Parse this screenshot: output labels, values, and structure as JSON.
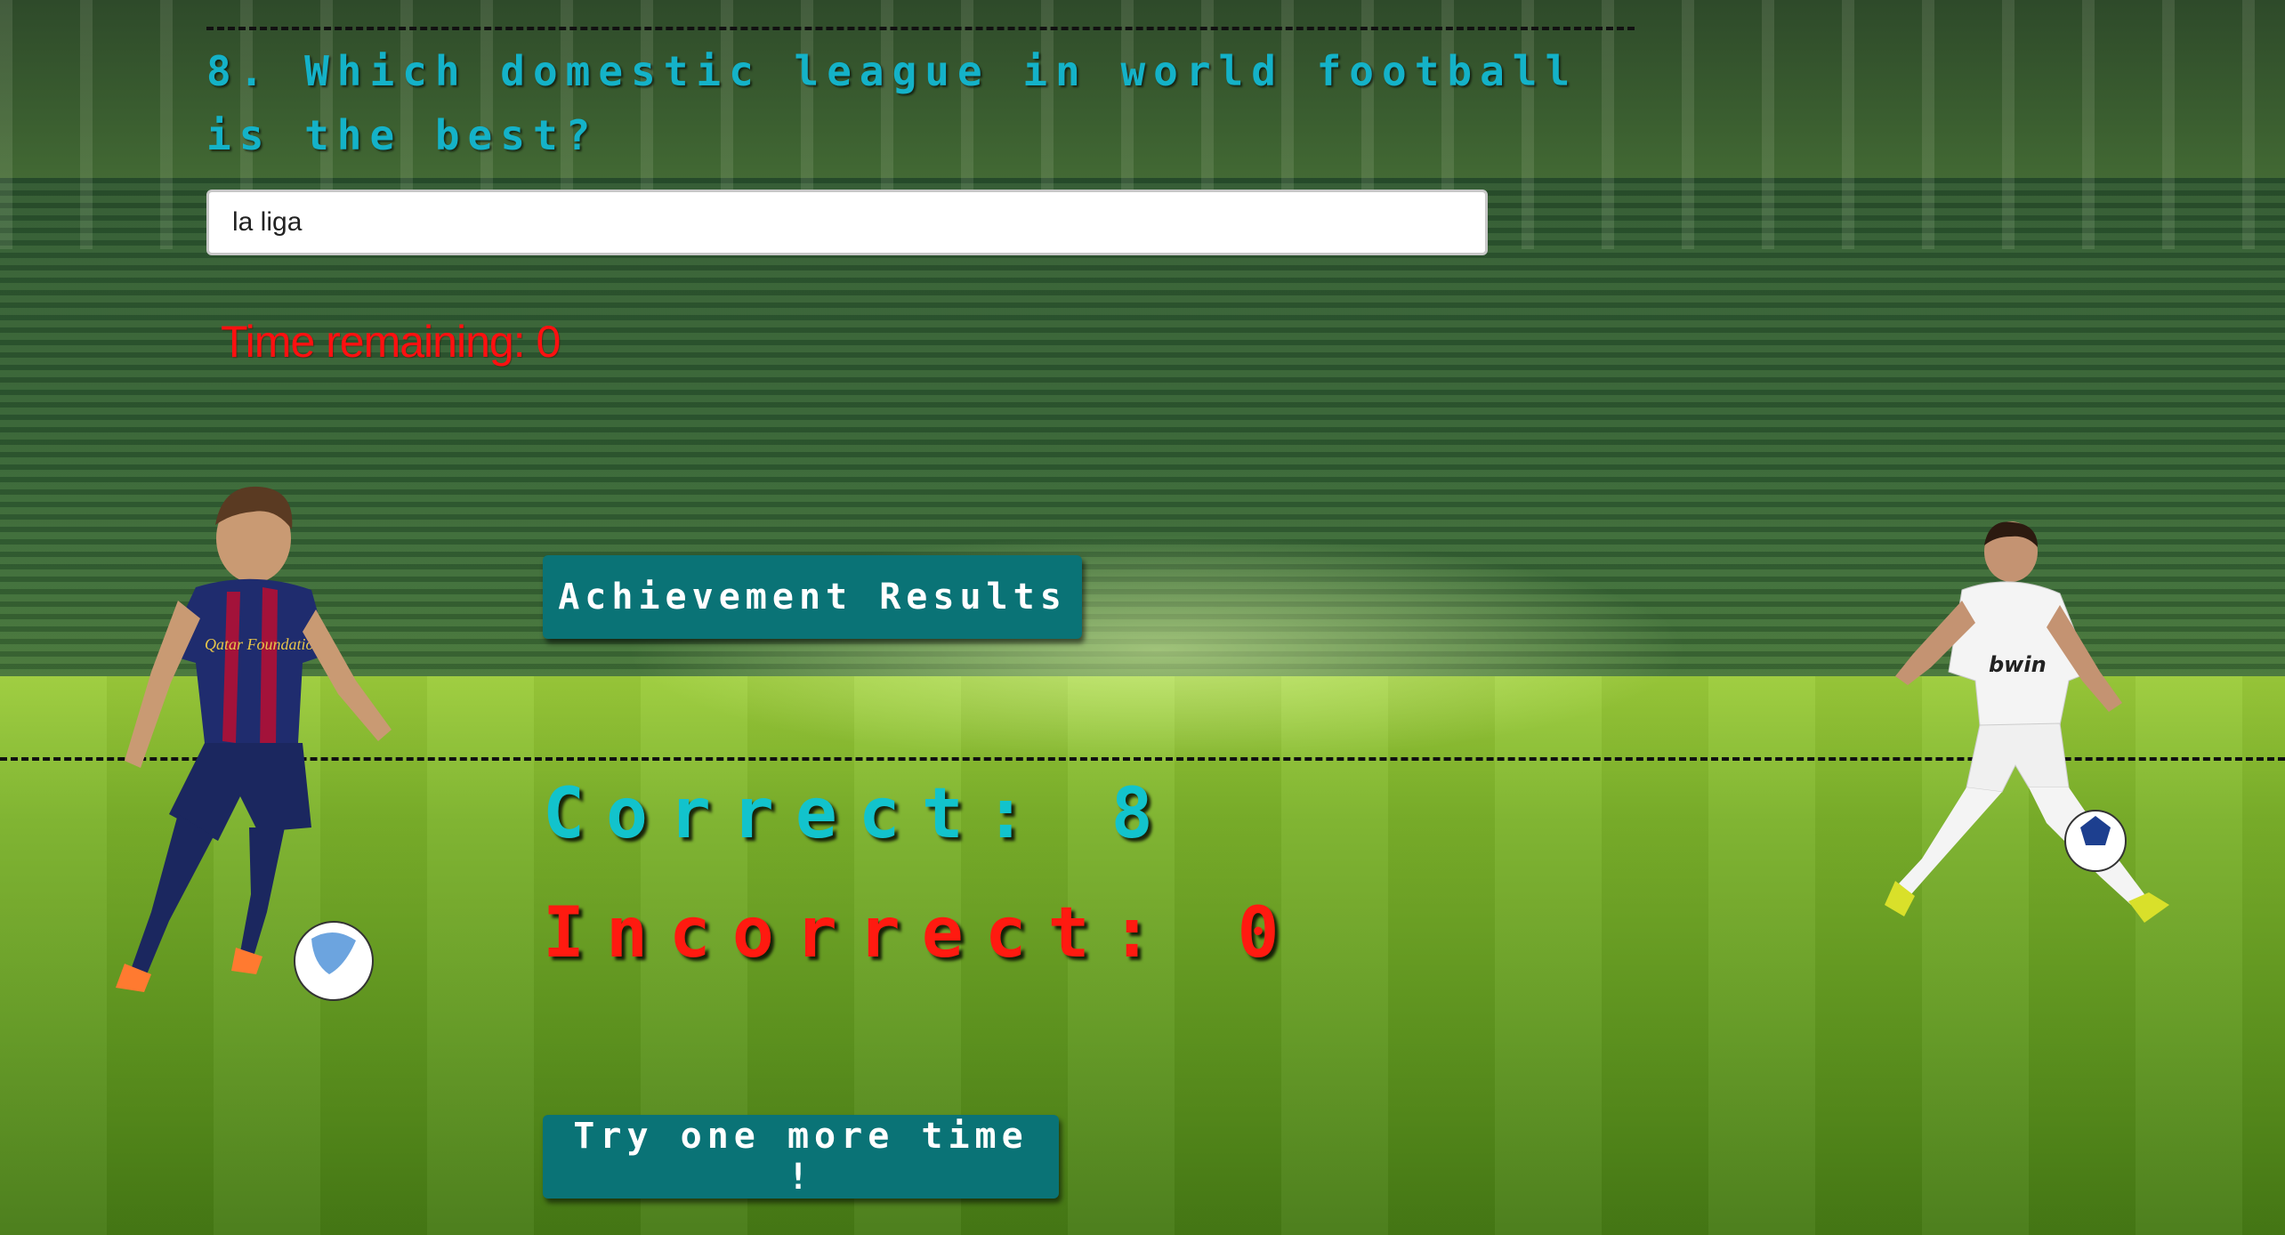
{
  "quiz": {
    "question": "8. Which domestic league in world football is the best?",
    "answer_value": "la liga",
    "timer_text": "Time remaining: 0"
  },
  "buttons": {
    "results_label": "Achievement Results",
    "retry_label": "Try one more time !"
  },
  "score": {
    "correct_text": "Correct: 8",
    "incorrect_text": "Incorrect: 0"
  },
  "images": {
    "left_player_jersey_text": "Qatar Foundation",
    "right_player_jersey_text": "bwin"
  },
  "colors": {
    "question": "#14b2c8",
    "timer": "#ff1010",
    "button": "#0a7376",
    "correct": "#12c3cc",
    "incorrect": "#ff1a10"
  },
  "icons": [
    "left-player-image",
    "right-player-image",
    "soccer-ball-icon"
  ]
}
